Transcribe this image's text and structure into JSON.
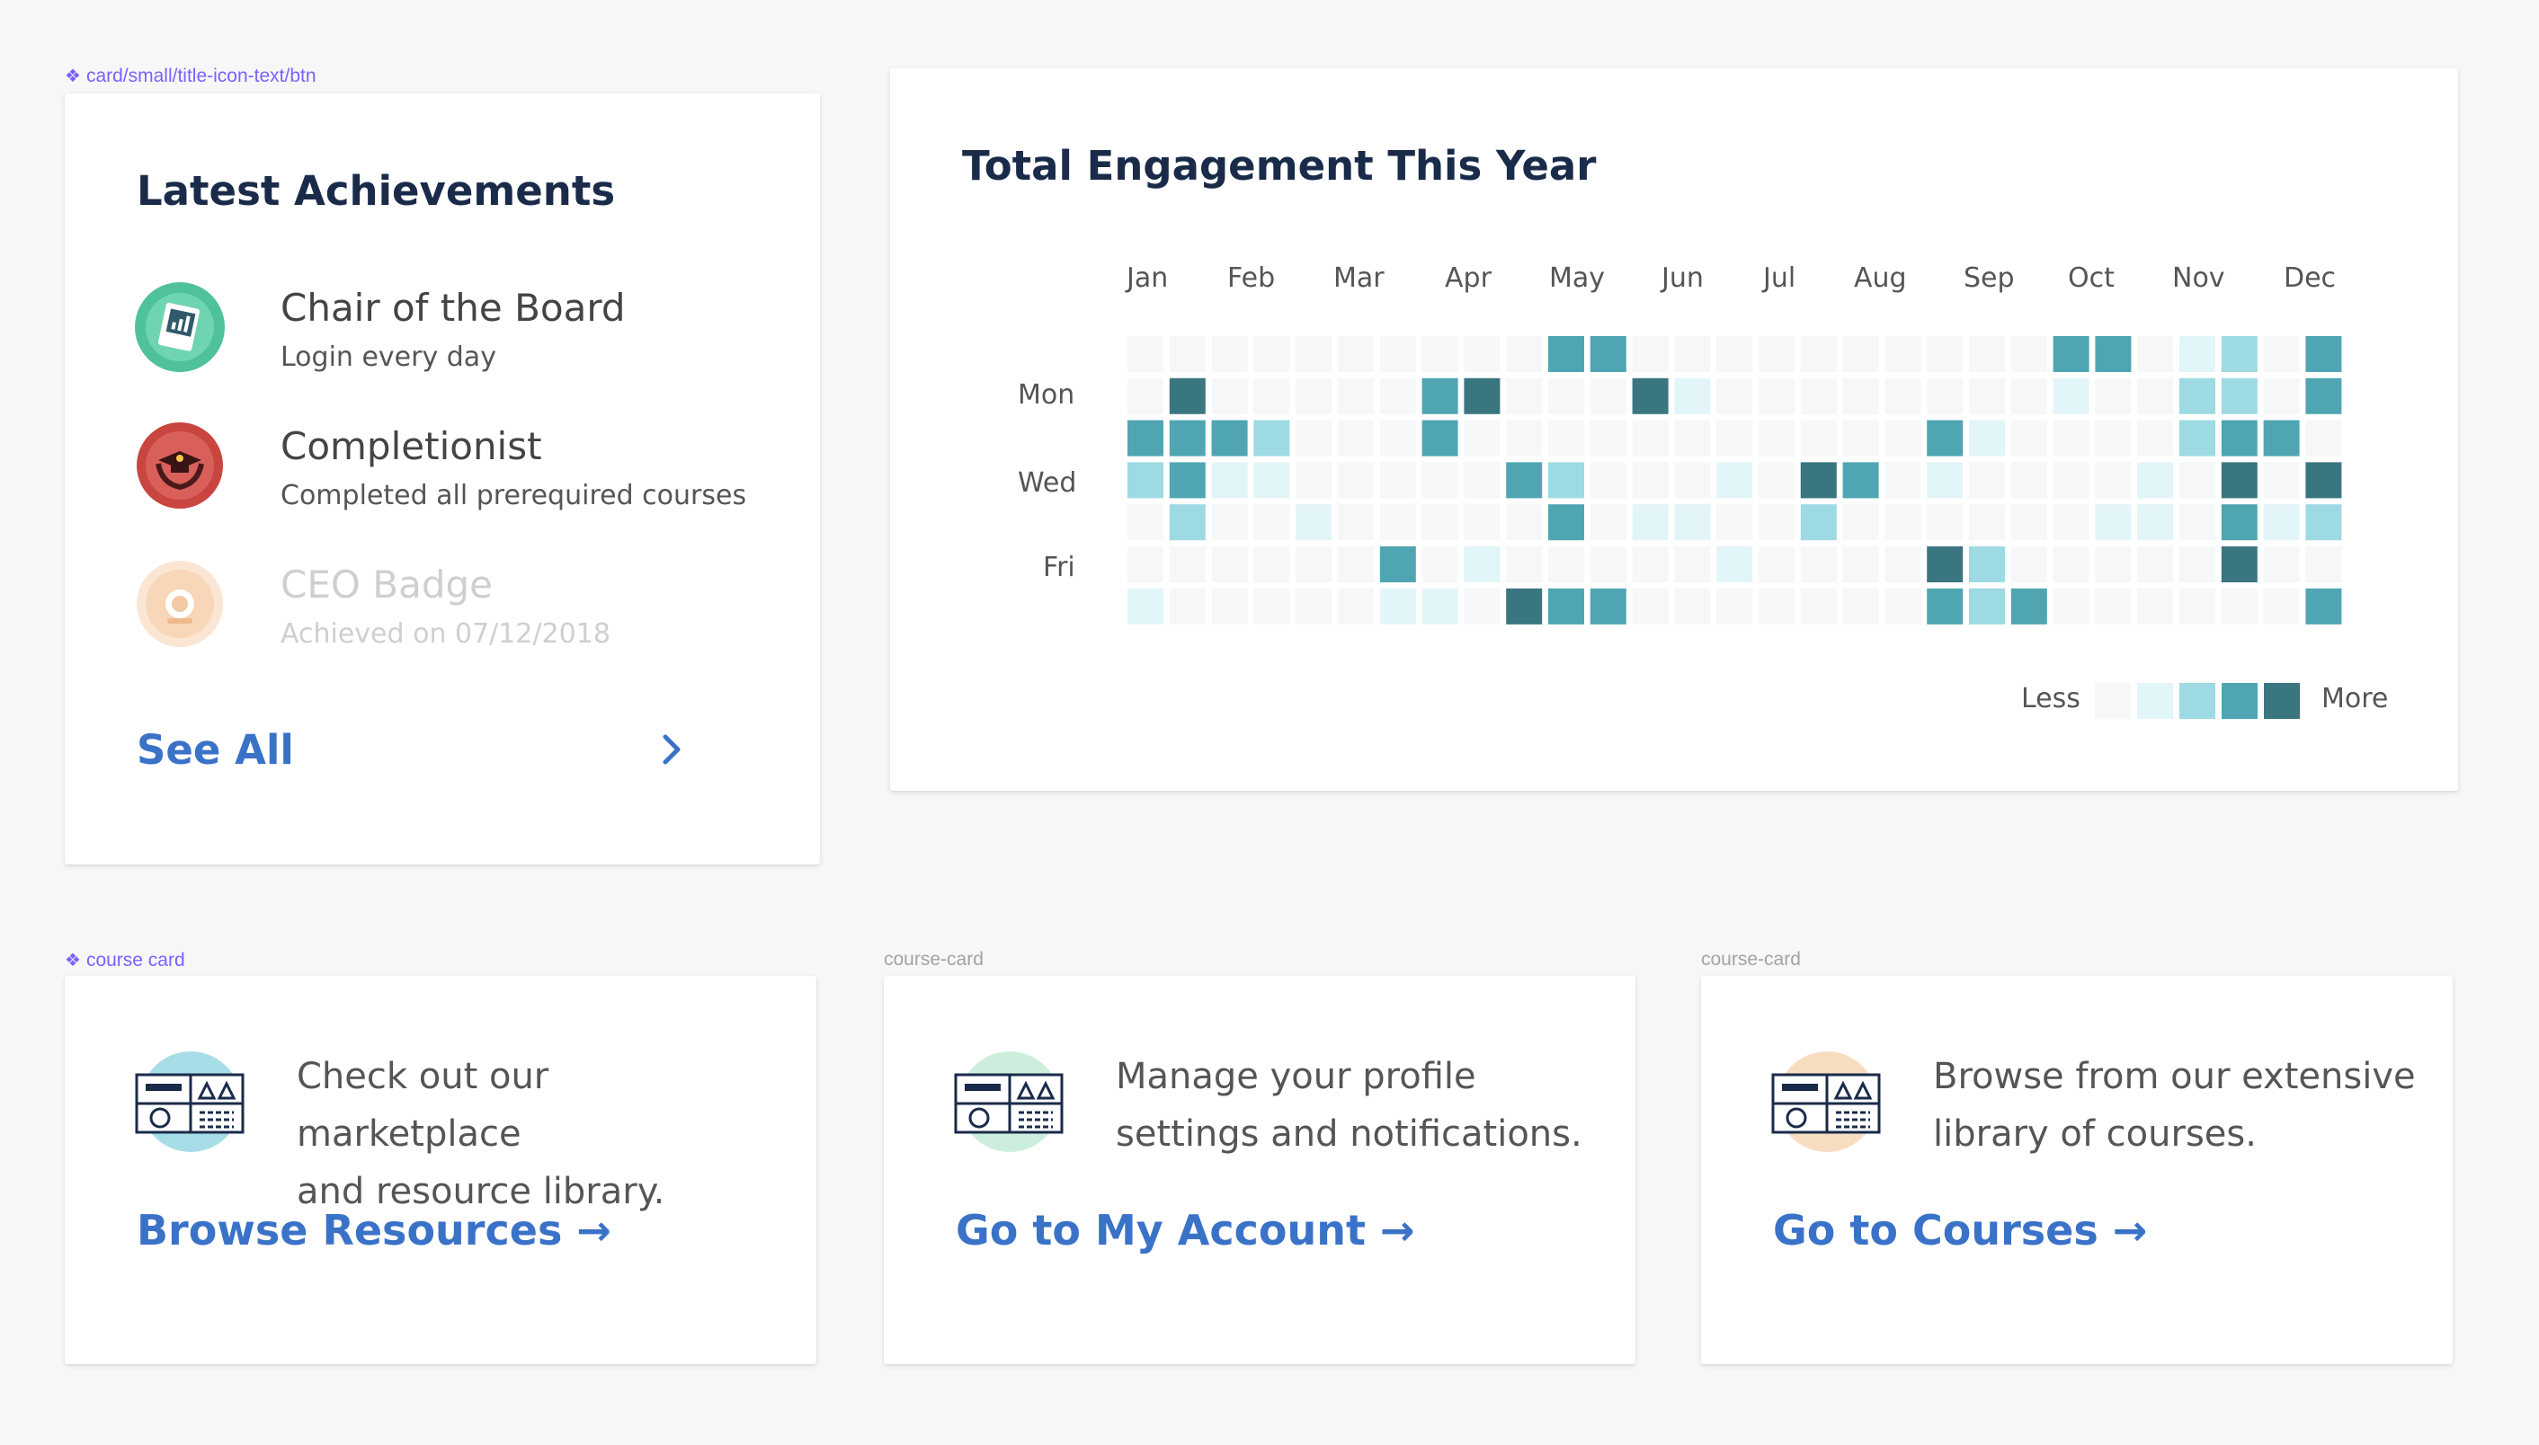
{
  "labels": {
    "achievements_frame": "card/small/title-icon-text/btn",
    "course_frame_main": "course card",
    "course_frame_2": "course-card",
    "course_frame_3": "course-card"
  },
  "achievements": {
    "title": "Latest Achievements",
    "items": [
      {
        "name": "Chair of the Board",
        "desc": "Login every day",
        "icon": "chart-document-icon",
        "color": "#4fc29a"
      },
      {
        "name": "Completionist",
        "desc": "Completed all prerequired courses",
        "icon": "graduation-laurel-icon",
        "color": "#c9453f"
      },
      {
        "name": "CEO Badge",
        "desc": "Achieved  on 07/12/2018",
        "icon": "ceo-badge-icon",
        "color": "#f5c9a2"
      }
    ],
    "see_all": "See All"
  },
  "engagement": {
    "title": "Total Engagement This Year",
    "months": [
      "Jan",
      "Feb",
      "Mar",
      "Apr",
      "May",
      "Jun",
      "Jul",
      "Aug",
      "Sep",
      "Oct",
      "Nov",
      "Dec"
    ],
    "days": [
      "Mon",
      "Wed",
      "Fri"
    ],
    "legend_less": "Less",
    "legend_more": "More",
    "colors": [
      "#f6f7f8",
      "#e2f5f8",
      "#9edae3",
      "#4fa6b2",
      "#3a7680"
    ],
    "grid": [
      [
        0,
        0,
        0,
        0,
        0,
        0,
        0,
        0,
        0,
        0,
        3,
        3,
        0,
        0,
        0,
        0,
        0,
        0,
        0,
        0,
        0,
        0,
        3,
        3,
        0,
        1,
        2,
        0,
        3
      ],
      [
        0,
        4,
        0,
        0,
        0,
        0,
        0,
        3,
        4,
        0,
        0,
        0,
        4,
        1,
        0,
        0,
        0,
        0,
        0,
        0,
        0,
        0,
        1,
        0,
        0,
        2,
        2,
        0,
        3
      ],
      [
        3,
        3,
        3,
        2,
        0,
        0,
        0,
        3,
        0,
        0,
        0,
        0,
        0,
        0,
        0,
        0,
        0,
        0,
        0,
        3,
        1,
        0,
        0,
        0,
        0,
        2,
        3,
        3,
        0
      ],
      [
        2,
        3,
        1,
        1,
        0,
        0,
        0,
        0,
        0,
        3,
        2,
        0,
        0,
        0,
        1,
        0,
        4,
        3,
        0,
        1,
        0,
        0,
        0,
        0,
        1,
        0,
        4,
        0,
        4
      ],
      [
        0,
        2,
        0,
        0,
        1,
        0,
        0,
        0,
        0,
        0,
        3,
        0,
        1,
        1,
        0,
        0,
        2,
        0,
        0,
        0,
        0,
        0,
        0,
        1,
        1,
        0,
        3,
        1,
        2
      ],
      [
        0,
        0,
        0,
        0,
        0,
        0,
        3,
        0,
        1,
        0,
        0,
        0,
        0,
        0,
        1,
        0,
        0,
        0,
        0,
        4,
        2,
        0,
        0,
        0,
        0,
        0,
        4,
        0,
        0
      ],
      [
        1,
        0,
        0,
        0,
        0,
        0,
        1,
        1,
        0,
        4,
        3,
        3,
        0,
        0,
        0,
        0,
        0,
        0,
        0,
        3,
        2,
        3,
        0,
        0,
        0,
        0,
        0,
        0,
        3
      ]
    ]
  },
  "courses": [
    {
      "desc_line1": "Check out our marketplace",
      "desc_line2": "and resource library.",
      "cta": "Browse Resources →",
      "accent": "#a7dde6",
      "icon": "dashboard-layout-icon"
    },
    {
      "desc_line1": "Manage your profile",
      "desc_line2": "settings and notifications.",
      "cta": "Go to My Account →",
      "accent": "#cdeedd",
      "icon": "dashboard-layout-icon"
    },
    {
      "desc_line1": "Browse from our extensive",
      "desc_line2": "library of courses.",
      "cta": "Go to Courses →",
      "accent": "#f7ddc0",
      "icon": "dashboard-layout-icon"
    }
  ]
}
